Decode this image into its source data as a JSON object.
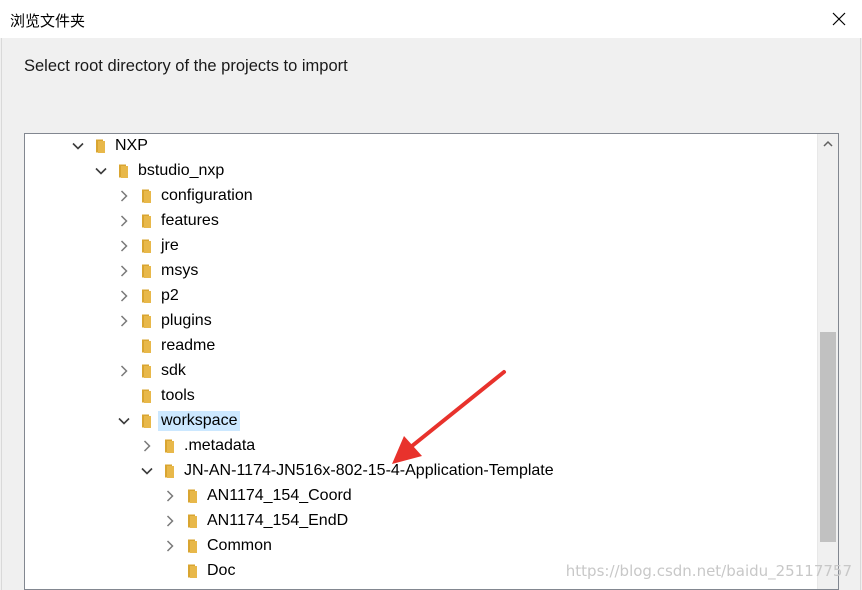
{
  "window": {
    "title": "浏览文件夹"
  },
  "dialog": {
    "instruction": "Select root directory of the projects to import"
  },
  "tree": {
    "items": [
      {
        "label": "NXP",
        "depth": 0,
        "expander": "expanded",
        "selected": false
      },
      {
        "label": "bstudio_nxp",
        "depth": 1,
        "expander": "expanded",
        "selected": false
      },
      {
        "label": "configuration",
        "depth": 2,
        "expander": "collapsed",
        "selected": false
      },
      {
        "label": "features",
        "depth": 2,
        "expander": "collapsed",
        "selected": false
      },
      {
        "label": "jre",
        "depth": 2,
        "expander": "collapsed",
        "selected": false
      },
      {
        "label": "msys",
        "depth": 2,
        "expander": "collapsed",
        "selected": false
      },
      {
        "label": "p2",
        "depth": 2,
        "expander": "collapsed",
        "selected": false
      },
      {
        "label": "plugins",
        "depth": 2,
        "expander": "collapsed",
        "selected": false
      },
      {
        "label": "readme",
        "depth": 2,
        "expander": "none",
        "selected": false
      },
      {
        "label": "sdk",
        "depth": 2,
        "expander": "collapsed",
        "selected": false
      },
      {
        "label": "tools",
        "depth": 2,
        "expander": "none",
        "selected": false
      },
      {
        "label": "workspace",
        "depth": 2,
        "expander": "expanded",
        "selected": true
      },
      {
        "label": ".metadata",
        "depth": 3,
        "expander": "collapsed",
        "selected": false
      },
      {
        "label": "JN-AN-1174-JN516x-802-15-4-Application-Template",
        "depth": 3,
        "expander": "expanded",
        "selected": false
      },
      {
        "label": "AN1174_154_Coord",
        "depth": 4,
        "expander": "collapsed",
        "selected": false
      },
      {
        "label": "AN1174_154_EndD",
        "depth": 4,
        "expander": "collapsed",
        "selected": false
      },
      {
        "label": "Common",
        "depth": 4,
        "expander": "collapsed",
        "selected": false
      },
      {
        "label": "Doc",
        "depth": 4,
        "expander": "none",
        "selected": false
      },
      {
        "label": "",
        "depth": 4,
        "expander": "none",
        "selected": false
      }
    ]
  },
  "watermark": "https://blog.csdn.net/baidu_25117757",
  "colors": {
    "folder": "#e8b84a",
    "folder_dark": "#d9a531",
    "selection": "#cce8ff",
    "annotation_arrow": "#e8322c"
  },
  "icons": {
    "close": "close-icon",
    "folder": "folder-icon",
    "expanded": "chevron-down-icon",
    "collapsed": "chevron-right-icon"
  }
}
